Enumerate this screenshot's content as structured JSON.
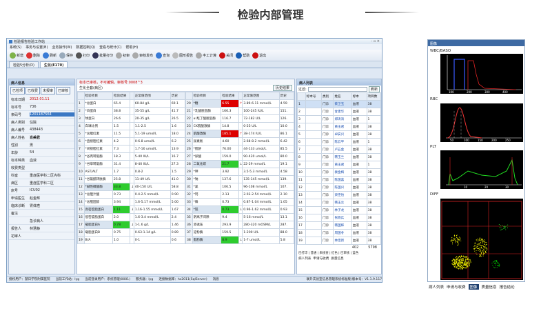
{
  "header": {
    "title": "检验内部管理"
  },
  "window": {
    "title": "检验报告检验工作站",
    "controls": "- ▫ ×"
  },
  "menu": [
    "系统(S)",
    "事务与设置(B)",
    "业务操作(W)",
    "数据控制(Q)",
    "查看与统计(C)",
    "帮助(H)"
  ],
  "toolbar": [
    "新增",
    "删除",
    "刷新",
    "保存",
    "打印",
    "批量打印",
    "初审",
    "审核发布",
    "查询",
    "图形报告",
    "丰工计算",
    "关闭",
    "帮助",
    "退出"
  ],
  "tabs": [
    "检验5分析(D)",
    "生化(E170)"
  ],
  "patient": {
    "panel_title": "病人信息",
    "buttons": [
      "已检项",
      "已收费",
      "未报审",
      "已审核"
    ],
    "rows": [
      {
        "k": "标本日期",
        "v": "2012.01.11"
      },
      {
        "k": "标本号",
        "v": "736"
      },
      {
        "k": "条码号",
        "v": "1201187564"
      },
      {
        "k": "病人类别",
        "v": "住院"
      },
      {
        "k": "病人编号",
        "v": "438443"
      },
      {
        "k": "病人姓名",
        "v": "肖美君"
      },
      {
        "k": "性别",
        "v": "男"
      },
      {
        "k": "年龄",
        "v": "54"
      },
      {
        "k": "标本种类",
        "v": "血液"
      },
      {
        "k": "收费类型",
        "v": ""
      },
      {
        "k": "科室",
        "v": "重症医学科二区内科"
      },
      {
        "k": "病区",
        "v": "重症医学科二区"
      },
      {
        "k": "床号",
        "v": "ICU02"
      },
      {
        "k": "申请医生",
        "v": "赵金辉"
      },
      {
        "k": "临床诊断",
        "v": "胃体癌"
      },
      {
        "k": "备注",
        "v": ""
      },
      {
        "k": "",
        "v": "急诊病人"
      },
      {
        "k": "报告人",
        "v": "林慧静"
      },
      {
        "k": "初审人",
        "v": ""
      }
    ]
  },
  "results": {
    "warning": "标本已审核，不可编辑，审核号:0008^3",
    "sub": "生化全套(病区)",
    "history_button": "历史结果",
    "headers": [
      "",
      "检验项目",
      "检验结果",
      "",
      "正常值范围",
      "历史"
    ],
    "left": [
      [
        "1",
        "*总蛋白",
        "65.4",
        "",
        "60-84 g/L",
        "69.1"
      ],
      [
        "2",
        "*白蛋白",
        "38.8",
        "",
        "35-55 g/L",
        "41.7"
      ],
      [
        "3",
        "球蛋白",
        "26.6",
        "",
        "20-35 g/L",
        "26.5"
      ],
      [
        "4",
        "白球比例",
        "1.5",
        "",
        "1.1-2.5",
        "1.6"
      ],
      [
        "5",
        "*总胆红素",
        "11.5",
        "",
        "5.1-19 umol/L",
        "18.0"
      ],
      [
        "6",
        "*直接胆红素",
        "4.2",
        "",
        "0-6.8 umol/L",
        "6.2"
      ],
      [
        "7",
        "*间接胆红素",
        "7.3",
        "",
        "1.7-16 umol/L",
        "13.9"
      ],
      [
        "8",
        "*谷丙转氨酶",
        "18.3",
        "",
        "5-40 IU/L",
        "16.7"
      ],
      [
        "9",
        "*谷草转氨酶",
        "31.4",
        "",
        "8-40 IU/L",
        "27.3"
      ],
      [
        "10",
        "AST/ALT",
        "1.7",
        "",
        "0.8-2",
        "1.5"
      ],
      [
        "11",
        "*谷氨酰转肽酶",
        "25.8",
        "",
        "11-49 U/L",
        "41.0"
      ],
      [
        "12",
        "*碱性磷酸酶",
        "33.8",
        "↓",
        "40-150 U/L",
        "58.8"
      ],
      [
        "13",
        "*总胆汁酸",
        "0.73",
        "",
        "0.4-2.5 mmol/L",
        "0.90"
      ],
      [
        "14",
        "*总胆固醇",
        "3.94",
        "",
        "1.6-5.17 mmol/L",
        "5.00"
      ],
      [
        "15",
        "高密度脂蛋白",
        "1.11",
        "↓",
        "1.16-1.55 mmol/L",
        "1.67"
      ],
      [
        "16",
        "低密度脂蛋白",
        "2.0",
        "",
        "1.6-3.4 mmol/L",
        "2.4"
      ],
      [
        "17",
        "载脂蛋白A",
        "0.78",
        "↓",
        "1-1.6 g/L",
        "1.46"
      ],
      [
        "18",
        "载脂蛋白B",
        "0.75",
        "",
        "0.63-1.14 g/L",
        "0.89"
      ],
      [
        "19",
        "B/A",
        "1.0",
        "",
        "0-1",
        "0.6"
      ]
    ],
    "right": [
      [
        "20",
        "*糖",
        "6.55",
        "↑",
        "3.89-6.11 mmol/L",
        "4.59"
      ],
      [
        "21",
        "*乳酸脱氢酶",
        "166.3",
        "",
        "100-245 IU/L",
        "151."
      ],
      [
        "22",
        "α-羟丁酸脱氢酶",
        "116.7",
        "",
        "72-182 U/L",
        "126."
      ],
      [
        "23",
        "CK肌酸激酶",
        "14.8",
        "",
        "0-25 U/L",
        "10.0"
      ],
      [
        "24",
        "肌酸激酶",
        "185.1",
        "↑",
        "38-174 IU/L",
        "86.1"
      ],
      [
        "25",
        "尿素氮",
        "4.60",
        "",
        "2.68-8.2 mmol/L",
        "6.42"
      ],
      [
        "26",
        "*肌酐",
        "76.00",
        "",
        "44-133 umol/L",
        "85.5"
      ],
      [
        "27",
        "*尿酸",
        "159.0",
        "",
        "90-420 umol/L",
        "80.0"
      ],
      [
        "28",
        "二氧化碳",
        "21.7",
        "↓",
        "22-29 mmol/L",
        "19.1"
      ],
      [
        "29",
        "*钾",
        "3.92",
        "",
        "3.5-5.3 mmol/L",
        "4.58"
      ],
      [
        "30",
        "*钠",
        "137.6",
        "",
        "135-145 mmol/L",
        "139."
      ],
      [
        "31",
        "*氯",
        "106.5",
        "",
        "96-108 mmol/L",
        "107."
      ],
      [
        "32",
        "*钙",
        "2.13",
        "",
        "2.03-2.54 mmol/L",
        "2.10"
      ],
      [
        "33",
        "*磷",
        "0.73",
        "",
        "0.87-1.04 mmol/L",
        "1.05"
      ],
      [
        "34",
        "*镁",
        "0.73",
        "↓",
        "0.96-1.62 mmol/L",
        "0.93"
      ],
      [
        "35",
        "阴离子间隙",
        "9.4",
        "",
        "5-16 mmol/L",
        "13.1"
      ],
      [
        "36",
        "渗透压",
        "293.9",
        "",
        "280-320 mOSM/L",
        "287."
      ],
      [
        "37",
        "淀粉酶",
        "159.5",
        "",
        "1-200 U/L",
        "88.0"
      ],
      [
        "38",
        "脂肪酶",
        "8.9",
        "↓",
        "1-7 umol/L",
        "5.8"
      ]
    ]
  },
  "list": {
    "panel_title": "病人列表",
    "filter_label": "过滤:",
    "refresh": "刷新",
    "headers": [
      "",
      "标本号",
      "类别",
      "姓名",
      "标本",
      "项目数"
    ],
    "rows": [
      [
        "1",
        "",
        "门诊",
        "蔡卫玉",
        "血液",
        "38"
      ],
      [
        "2",
        "",
        "门诊",
        "甘建华",
        "血液",
        "38"
      ],
      [
        "3",
        "",
        "门诊",
        "郑涛涛",
        "血液",
        "1"
      ],
      [
        "4",
        "",
        "门诊",
        "黄玉君",
        "血液",
        "38"
      ],
      [
        "5",
        "",
        "门诊",
        "卓安兴",
        "血液",
        "38"
      ],
      [
        "6",
        "",
        "门诊",
        "陈云平",
        "血液",
        "1"
      ],
      [
        "7",
        "",
        "门诊",
        "卢五金",
        "血液",
        "38"
      ],
      [
        "8",
        "",
        "门诊",
        "韩玉兰",
        "血液",
        "38"
      ],
      [
        "9",
        "",
        "门诊",
        "黄玉君",
        "血液",
        "1"
      ],
      [
        "10",
        "",
        "门诊",
        "秦金梅",
        "血液",
        "38"
      ],
      [
        "11",
        "",
        "门诊",
        "陈国喜",
        "血液",
        "38"
      ],
      [
        "12",
        "",
        "门诊",
        "陈国兴",
        "血液",
        "38"
      ],
      [
        "13",
        "",
        "门诊",
        "梁佳怡",
        "血液",
        "38"
      ],
      [
        "14",
        "",
        "门诊",
        "韩玉兰",
        "血液",
        "38"
      ],
      [
        "15",
        "",
        "门诊",
        "林子龙",
        "血液",
        "38"
      ],
      [
        "16",
        "",
        "门诊",
        "张晓兵",
        "血液",
        "38"
      ],
      [
        "17",
        "",
        "门诊",
        "韩国辉",
        "血液",
        "38"
      ],
      [
        "18",
        "",
        "门诊",
        "周国冬",
        "血液",
        "38"
      ],
      [
        "19",
        "",
        "门诊",
        "林佳新",
        "血液",
        "38"
      ]
    ],
    "total_count": "402",
    "total_items": "5798",
    "legend": "已打印 | 普通 | 未核查 | 红色 | 已审核 | 蓝色",
    "bottom_tabs": [
      "病人列表",
      "申请与收费",
      "质量信息"
    ]
  },
  "statusbar": [
    "授权用户：慧日学院附属医院",
    "当前工作站：lyg",
    "当前登录用户：系统管理(0001)",
    "服务器：lyg",
    "连接数据库：hs2011(SqlServer)",
    "消息",
    "联升实验室信息管理系统标准版(版本号：V1.1.9.117)"
  ],
  "graph": {
    "title": "图像",
    "labels": [
      "WBC/BASO",
      "RBC",
      "PLT",
      "DIFF"
    ],
    "axis": [
      "100",
      "200",
      "300",
      "400",
      "50",
      "100",
      "150",
      "200",
      "250",
      "10",
      "20",
      "30"
    ],
    "tabs": [
      "病人列表",
      "申请与收费",
      "图像",
      "质量信息",
      "报告结论"
    ]
  }
}
